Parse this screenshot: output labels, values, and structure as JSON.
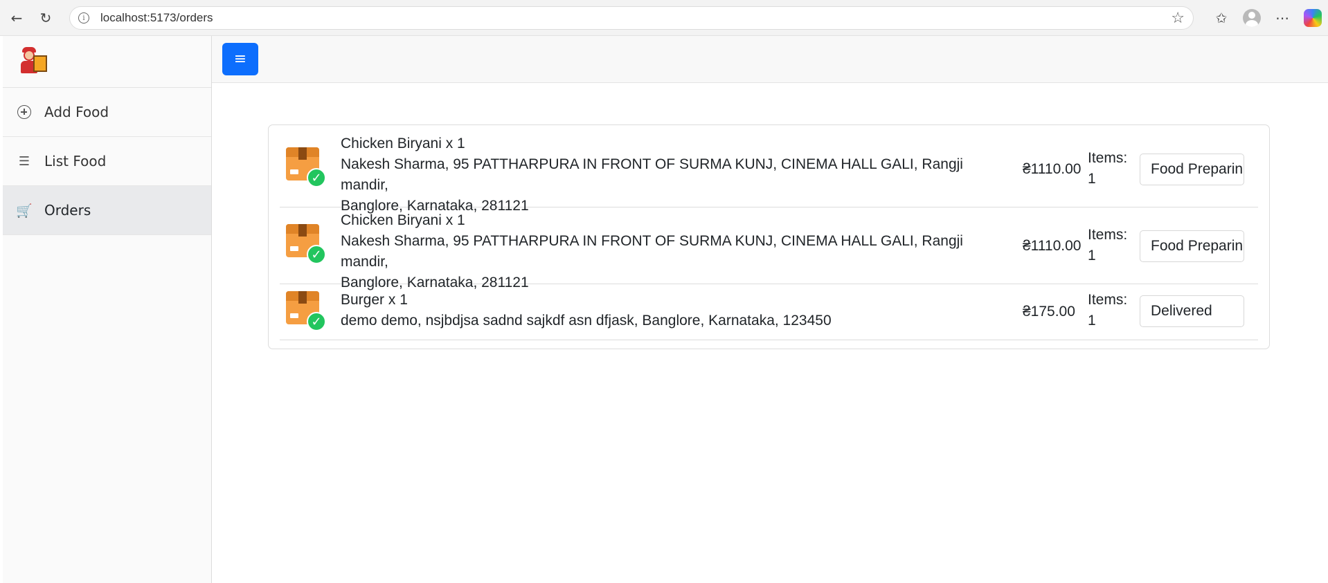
{
  "browser": {
    "url": "localhost:5173/orders",
    "icons": [
      "back-arrow-icon",
      "reload-icon",
      "info-icon",
      "star-icon",
      "favorites-icon",
      "profile-icon",
      "more-icon",
      "copilot-icon"
    ]
  },
  "sidebar": {
    "items": [
      {
        "label": "Add Food",
        "icon": "plus-circle-icon"
      },
      {
        "label": "List Food",
        "icon": "list-icon"
      },
      {
        "label": "Orders",
        "icon": "cart-icon",
        "active": true
      }
    ]
  },
  "topbar": {
    "menu_icon": "≡",
    "accent": "#0d6efd"
  },
  "orders": [
    {
      "items_line": "Chicken Biryani x 1",
      "address_line1": "Nakesh Sharma, 95 PATTHARPURA IN FRONT OF SURMA KUNJ, CINEMA HALL GALI, Rangji mandir,",
      "address_line2": "Banglore, Karnataka, 281121",
      "price": "₴1110.00",
      "items_label": "Items:",
      "items_count": "1",
      "status": "Food Preparing"
    },
    {
      "items_line": "Chicken Biryani x 1",
      "address_line1": "Nakesh Sharma, 95 PATTHARPURA IN FRONT OF SURMA KUNJ, CINEMA HALL GALI, Rangji mandir,",
      "address_line2": "Banglore, Karnataka, 281121",
      "price": "₴1110.00",
      "items_label": "Items:",
      "items_count": "1",
      "status": "Food Preparing"
    },
    {
      "items_line": "Burger x 1",
      "address_line1": "demo demo, nsjbdjsa sadnd sajkdf asn dfjask, Banglore, Karnataka, 123450",
      "price": "₴175.00",
      "items_label": "Items:",
      "items_count": "1",
      "status": "Delivered"
    }
  ],
  "colors": {
    "status_check": "#22c55e",
    "package": "#f59e42"
  }
}
